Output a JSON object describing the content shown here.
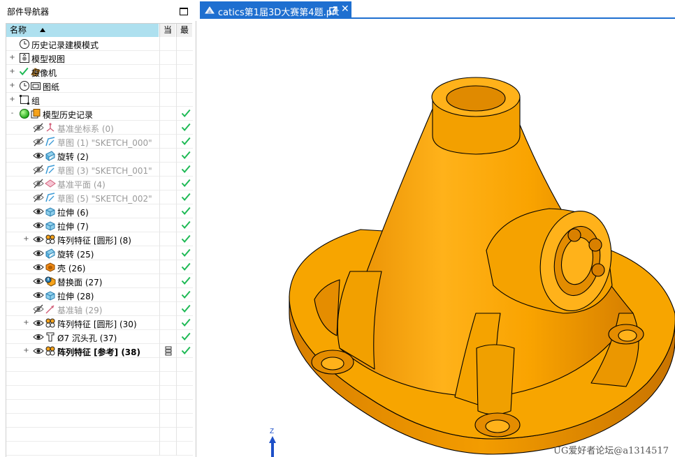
{
  "navigator": {
    "title": "部件导航器",
    "columns": {
      "name": "名称",
      "current": "当",
      "latest": "最"
    },
    "rows": [
      {
        "label": "历史记录建模模式",
        "icon": "clock-icon",
        "style": "normal",
        "check": false,
        "expander": ""
      },
      {
        "label": "模型视图",
        "icon": "model-view-icon",
        "style": "normal",
        "check": false,
        "expander": "+"
      },
      {
        "label": "摄像机",
        "icon": "camera-icon",
        "style": "normal",
        "check": false,
        "expander": "+"
      },
      {
        "label": "图纸",
        "icon": "drawing-icon",
        "style": "normal",
        "check": false,
        "expander": "+"
      },
      {
        "label": "组",
        "icon": "group-icon",
        "style": "normal",
        "check": false,
        "expander": "+"
      },
      {
        "label": "模型历史记录",
        "icon": "history-icon",
        "style": "normal",
        "check": true,
        "expander": "-"
      },
      {
        "label": "基准坐标系 (0)",
        "icon": "datum-csys-icon",
        "style": "dim",
        "check": true,
        "expander": ""
      },
      {
        "label": "草图 (1) \"SKETCH_000\"",
        "icon": "sketch-icon",
        "style": "dim",
        "check": true,
        "expander": ""
      },
      {
        "label": "旋转 (2)",
        "icon": "revolve-icon",
        "style": "normal",
        "check": true,
        "expander": ""
      },
      {
        "label": "草图 (3) \"SKETCH_001\"",
        "icon": "sketch-icon",
        "style": "dim",
        "check": true,
        "expander": ""
      },
      {
        "label": "基准平面 (4)",
        "icon": "datum-plane-icon",
        "style": "dim",
        "check": true,
        "expander": ""
      },
      {
        "label": "草图 (5) \"SKETCH_002\"",
        "icon": "sketch-icon",
        "style": "dim",
        "check": true,
        "expander": ""
      },
      {
        "label": "拉伸 (6)",
        "icon": "extrude-icon",
        "style": "normal",
        "check": true,
        "expander": ""
      },
      {
        "label": "拉伸 (7)",
        "icon": "extrude-icon",
        "style": "normal",
        "check": true,
        "expander": ""
      },
      {
        "label": "阵列特征 [圆形] (8)",
        "icon": "pattern-icon",
        "style": "normal",
        "check": true,
        "expander": "+"
      },
      {
        "label": "旋转 (25)",
        "icon": "revolve-icon",
        "style": "normal",
        "check": true,
        "expander": ""
      },
      {
        "label": "壳 (26)",
        "icon": "shell-icon",
        "style": "normal",
        "check": true,
        "expander": ""
      },
      {
        "label": "替换面 (27)",
        "icon": "replace-face-icon",
        "style": "normal",
        "check": true,
        "expander": ""
      },
      {
        "label": "拉伸 (28)",
        "icon": "extrude-icon",
        "style": "normal",
        "check": true,
        "expander": ""
      },
      {
        "label": "基准轴 (29)",
        "icon": "datum-axis-icon",
        "style": "dim",
        "check": true,
        "expander": ""
      },
      {
        "label": "阵列特征 [圆形] (30)",
        "icon": "pattern-icon",
        "style": "normal",
        "check": true,
        "expander": "+"
      },
      {
        "label": "Ø7 沉头孔 (37)",
        "icon": "hole-icon",
        "style": "normal",
        "check": true,
        "expander": ""
      },
      {
        "label": "阵列特征 [参考] (38)",
        "icon": "pattern-icon",
        "style": "bold",
        "check": true,
        "expander": "+"
      }
    ]
  },
  "document_tab": {
    "label": "catics第1届3D大赛第4题.prt",
    "close_glyph": "✕"
  },
  "triad": {
    "z_label": "Z"
  },
  "watermark": "UG爱好者论坛@a1314517",
  "colors": {
    "tab_accent": "#1e6fd0",
    "model_orange": "#f7a300",
    "header_blue": "#aee0ef",
    "check_green": "#1db954"
  }
}
